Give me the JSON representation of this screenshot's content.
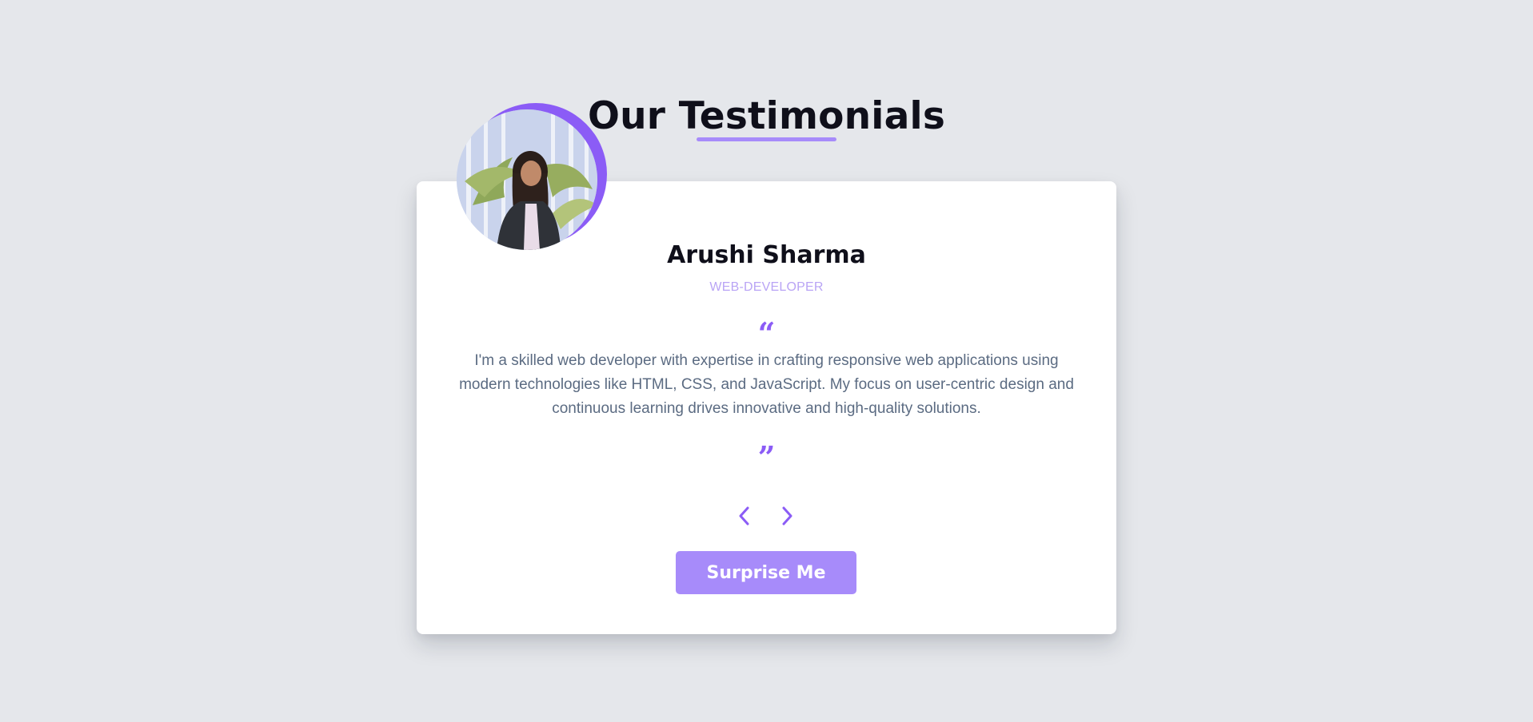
{
  "header": {
    "title": "Our Testimonials"
  },
  "testimonial": {
    "name": "Arushi Sharma",
    "role": "WEB-DEVELOPER",
    "text": "I'm a skilled web developer with expertise in crafting responsive web applications using modern technologies like HTML, CSS, and JavaScript. My focus on user-centric design and continuous learning drives innovative and high-quality solutions.",
    "quote_open": "“",
    "quote_close": "”"
  },
  "controls": {
    "prev_icon": "chevron-left-icon",
    "next_icon": "chevron-right-icon",
    "surprise_label": "Surprise Me"
  },
  "colors": {
    "accent": "#a78bfa",
    "accent_dark": "#8b5cf6",
    "background": "#e5e7eb",
    "card": "#ffffff",
    "body_text": "#5b6b82"
  }
}
